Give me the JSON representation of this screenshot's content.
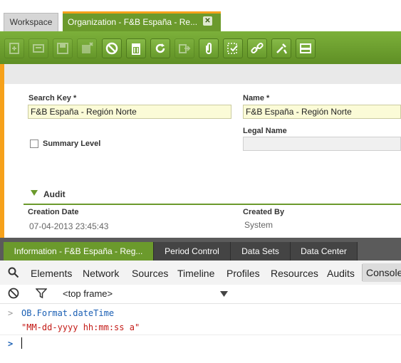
{
  "tabs": {
    "workspace": "Workspace",
    "organization": "Organization - F&B España - Re...",
    "close_glyph": "✕"
  },
  "toolbar": {
    "buttons": [
      "new-record",
      "new-document",
      "save",
      "save-close",
      "undo",
      "delete",
      "refresh",
      "export",
      "attach",
      "audit",
      "link",
      "tools",
      "grid"
    ]
  },
  "form": {
    "search_key_label": "Search Key *",
    "search_key_value": "F&B España - Región Norte",
    "name_label": "Name *",
    "name_value": "F&B España - Región Norte",
    "legal_name_label": "Legal Name",
    "legal_name_value": "",
    "summary_level_label": "Summary Level",
    "audit_section": "Audit",
    "creation_date_label": "Creation Date",
    "creation_date_value": "07-04-2013 23:45:43",
    "created_by_label": "Created By",
    "created_by_value": "System"
  },
  "bottom_tabs": [
    "Information - F&B España - Reg...",
    "Period Control",
    "Data Sets",
    "Data Center"
  ],
  "devtools": {
    "nav": [
      "Elements",
      "Network",
      "Sources",
      "Timeline",
      "Profiles",
      "Resources",
      "Audits",
      "Console"
    ],
    "frame_selector": "<top frame>",
    "console_input": "OB.Format.dateTime",
    "console_output": "\"MM-dd-yyyy hh:mm:ss a\"",
    "prompt": ">"
  },
  "colors": {
    "accent_green": "#6b9a2c",
    "accent_orange": "#f6a11a",
    "field_bg": "#fbfbd7"
  }
}
